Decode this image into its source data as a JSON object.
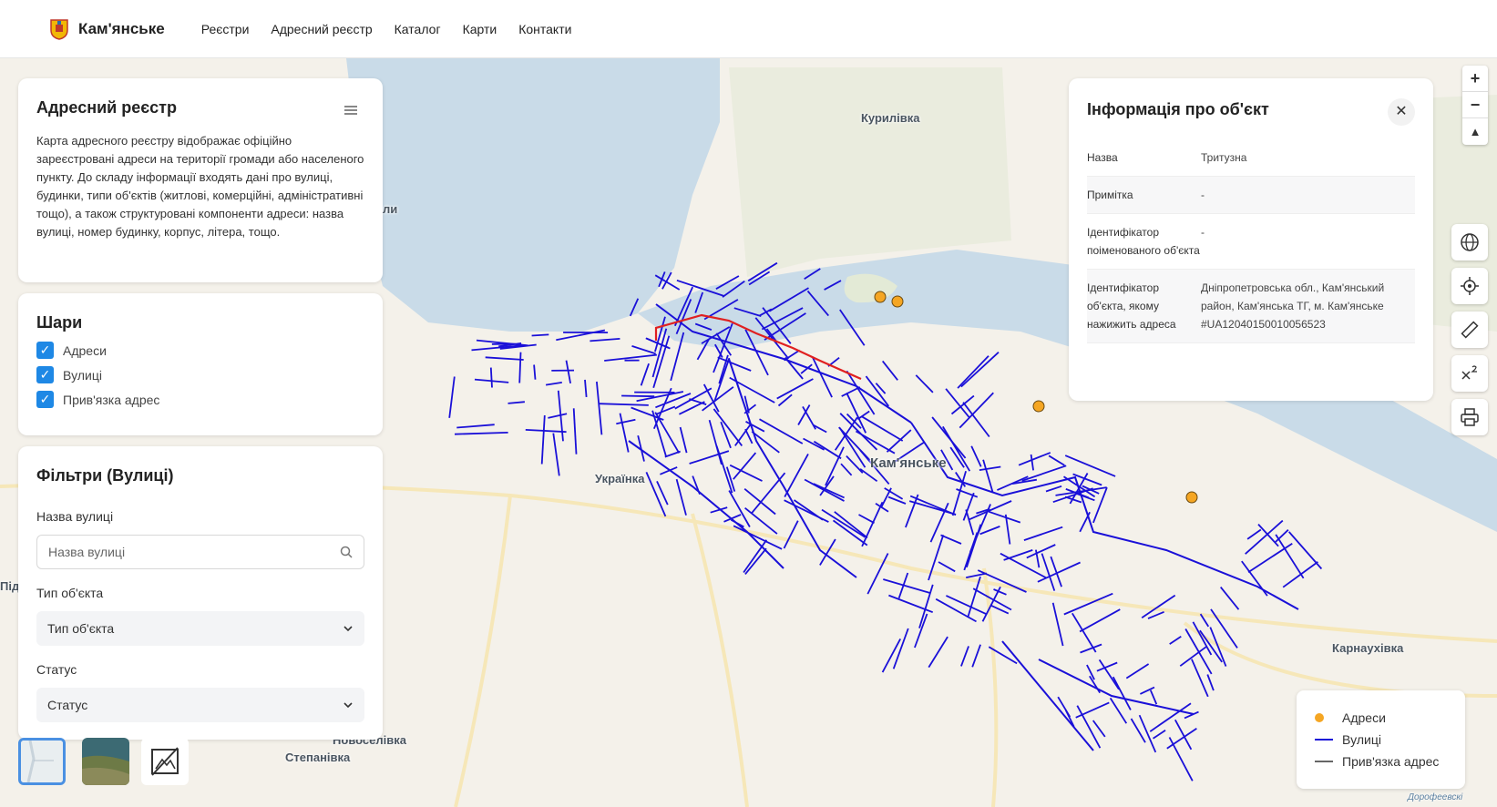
{
  "header": {
    "city": "Кам'янське",
    "nav": [
      "Реєстри",
      "Адресний реєстр",
      "Каталог",
      "Карти",
      "Контакти"
    ]
  },
  "about_panel": {
    "title": "Адресний реєстр",
    "description": "Карта адресного реєстру відображає офіційно зареєстровані адреси на території громади або населеного пункту. До складу інформації входять дані про вулиці, будинки, типи об'єктів (житлові, комерційні, адміністративні тощо), а також структуровані компоненти адреси: назва вулиці, номер будинку, корпус, літера, тощо."
  },
  "layers_panel": {
    "title": "Шари",
    "items": [
      {
        "label": "Адреси",
        "checked": true
      },
      {
        "label": "Вулиці",
        "checked": true
      },
      {
        "label": "Прив'язка адрес",
        "checked": true
      }
    ]
  },
  "filters_panel": {
    "title": "Фільтри (Вулиці)",
    "street_label": "Назва вулиці",
    "street_placeholder": "Назва вулиці",
    "type_label": "Тип об'єкта",
    "type_value": "Тип об'єкта",
    "status_label": "Статус",
    "status_value": "Статус"
  },
  "info_panel": {
    "title": "Інформація про об'єкт",
    "rows": [
      {
        "key": "Назва",
        "value": "Тритузна"
      },
      {
        "key": "Примітка",
        "value": "-"
      },
      {
        "key": "Ідентифікатор поіменованого об'єкта",
        "value": "-"
      },
      {
        "key": "Ідентифікатор об'єкта, якому нажижить адреса",
        "value": "Дніпропетровська обл., Кам'янський район, Кам'янська ТГ, м. Кам'янське #UA12040150010056523"
      }
    ]
  },
  "zoom": {
    "in": "+",
    "out": "−",
    "north": "▲"
  },
  "legend": {
    "items": [
      {
        "label": "Адреси",
        "color": "#f5a623",
        "kind": "dot"
      },
      {
        "label": "Вулиці",
        "color": "#1a10d8",
        "kind": "line"
      },
      {
        "label": "Прив'язка адрес",
        "color": "#666666",
        "kind": "line"
      }
    ]
  },
  "map_labels": {
    "kurylivka": "Курилівка",
    "ukrainka": "Українка",
    "kamianske": "Кам'янське",
    "karnaukhivka": "Карнаухівка",
    "novoselivka": "Новоселівка",
    "stepanivka": "Степанівка",
    "edge_pid": "Під",
    "edge_li": "ли",
    "dorofeevskyi": "Дорофеевскі"
  },
  "colors": {
    "streets": "#1a10d8",
    "selected_street": "#e02020",
    "addresses": "#f5a623",
    "water": "#c9dbe8",
    "land": "#f4f1ea",
    "accent": "#1e88e5"
  }
}
